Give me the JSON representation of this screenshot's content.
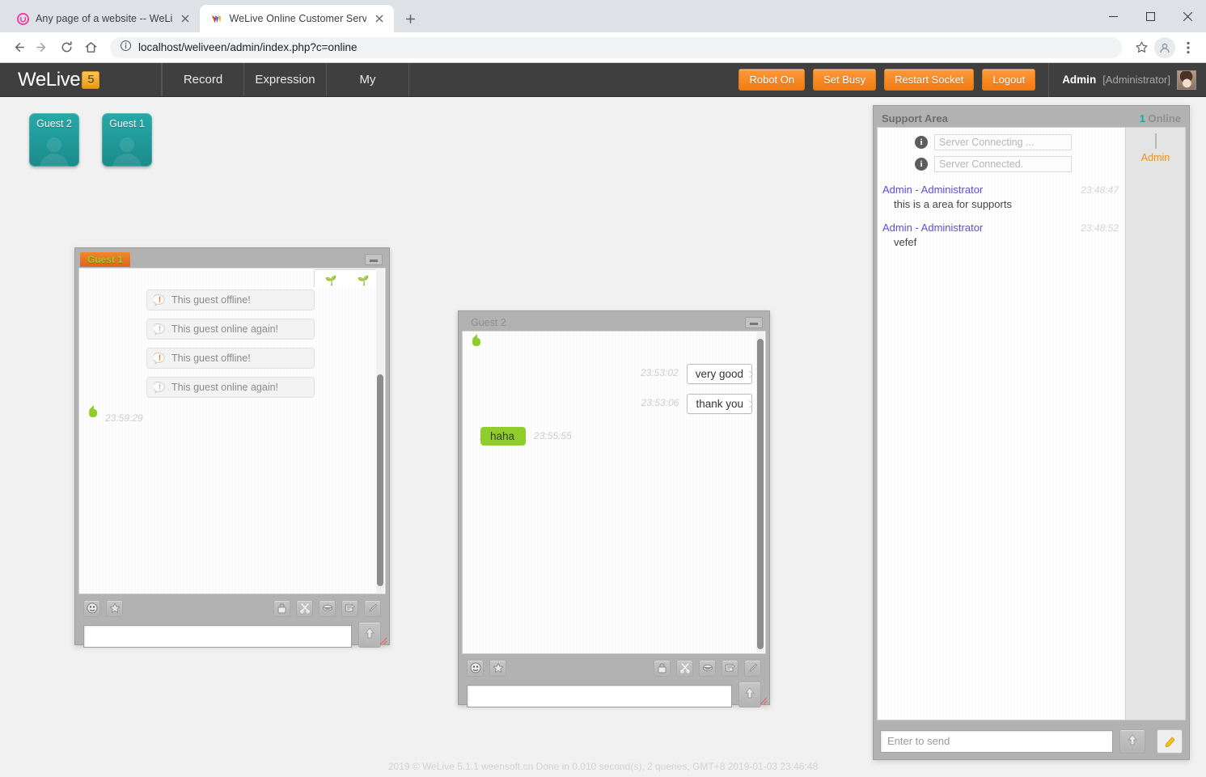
{
  "browser": {
    "tabs": [
      {
        "title": "Any page of a website -- WeLi",
        "favicon": "welive-pink-icon",
        "active": false
      },
      {
        "title": "WeLive Online Customer Servi",
        "favicon": "welive-colored-icon",
        "active": true
      }
    ],
    "newtab_label": "+",
    "url": "localhost/weliveen/admin/index.php?c=online",
    "icons": {
      "back": "back-arrow-icon",
      "forward": "forward-arrow-icon",
      "reload": "reload-icon",
      "home": "home-icon",
      "info": "site-info-icon",
      "bookmark": "star-icon",
      "profile": "profile-avatar-icon",
      "menu": "three-dot-menu-icon"
    },
    "window_controls": {
      "minimize": "minimize-icon",
      "maximize": "maximize-icon",
      "close": "close-icon"
    }
  },
  "navbar": {
    "brand": "WeLive",
    "brand_badge": "5",
    "items": [
      {
        "label": "Record"
      },
      {
        "label": "Expression"
      },
      {
        "label": "My"
      }
    ],
    "actions": [
      {
        "label": "Robot On"
      },
      {
        "label": "Set Busy"
      },
      {
        "label": "Restart Socket"
      },
      {
        "label": "Logout"
      }
    ],
    "user": {
      "name": "Admin",
      "role": "[Administrator]"
    },
    "colors": {
      "bar": "#403f3f",
      "button": "#f47b12"
    }
  },
  "guest_tiles": [
    {
      "label": "Guest 2"
    },
    {
      "label": "Guest 1"
    }
  ],
  "chat_windows": [
    {
      "title": "Guest 1",
      "active": true,
      "minimize_label": "minimize",
      "emoji_popup": [
        "🌱",
        "🌱"
      ],
      "system_messages": [
        "This guest offline!",
        "This guest online again!",
        "This guest offline!",
        "This guest online again!"
      ],
      "messages": [
        {
          "type": "image",
          "direction": "out",
          "image": "sunflower-photo",
          "time": "23:59:29"
        }
      ],
      "input_value": "",
      "toolbar": [
        "emoji-icon",
        "favorite-star-icon",
        "lock-icon",
        "scissors-icon",
        "smile-icon",
        "screenshot-icon",
        "pencil-icon"
      ],
      "send_label": "send"
    },
    {
      "title": "Guest 2",
      "active": false,
      "minimize_label": "minimize",
      "system_messages": [],
      "messages": [
        {
          "type": "image",
          "direction": "out",
          "image": "woman-photo",
          "time": ""
        },
        {
          "type": "text",
          "direction": "in",
          "text": "very good",
          "time": "23:53:02"
        },
        {
          "type": "text",
          "direction": "in",
          "text": "thank you",
          "time": "23:53:06"
        },
        {
          "type": "text",
          "direction": "out",
          "text": "haha",
          "time": "23:55:55"
        }
      ],
      "input_value": "",
      "toolbar": [
        "emoji-icon",
        "favorite-star-icon",
        "lock-icon",
        "scissors-icon",
        "smile-icon",
        "screenshot-icon",
        "pencil-icon"
      ],
      "send_label": "send"
    }
  ],
  "support": {
    "title": "Support Area",
    "online_count": "1",
    "online_label": "Online",
    "system_messages": [
      "Server Connecting ...",
      "Server Connected."
    ],
    "messages": [
      {
        "who": "Admin - Administrator",
        "time": "23:48:47",
        "text": "this is a area for supports"
      },
      {
        "who": "Admin - Administrator",
        "time": "23:48:52",
        "text": "vefef"
      }
    ],
    "users": [
      {
        "name": "Admin"
      }
    ],
    "input_placeholder": "Enter to send",
    "send_label": "send",
    "bell_label": "sound-toggle"
  },
  "footer": {
    "text": "2019 © WeLive 5.1.1 weensoft.cn Done in 0.010 second(s), 2 queries, GMT+8 2019-01-03 23:46:48"
  }
}
